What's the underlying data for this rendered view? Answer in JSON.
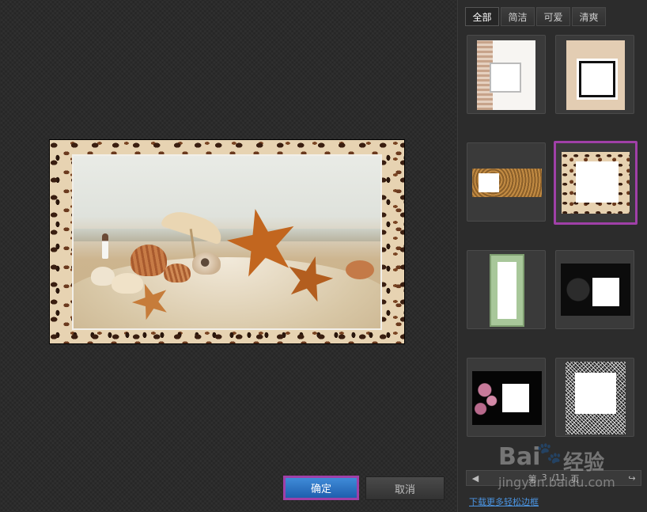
{
  "dialog": {
    "ok_label": "确定",
    "cancel_label": "取消"
  },
  "tabs": [
    {
      "label": "全部",
      "active": true
    },
    {
      "label": "简洁",
      "active": false
    },
    {
      "label": "可爱",
      "active": false
    },
    {
      "label": "清爽",
      "active": false
    }
  ],
  "frames": {
    "selected_index": 3,
    "selection_color": "#a040a8"
  },
  "pager": {
    "prev_icon": "arrow-left-icon",
    "next_icon": "arrow-right-icon",
    "text_page": "第",
    "current": "3",
    "total": "/11",
    "text_unit": "页"
  },
  "download_link": "下载更多轻松边框",
  "watermark": {
    "brand": "Bai",
    "brand_suffix": "经验",
    "url": "jingyan.baidu.com"
  }
}
